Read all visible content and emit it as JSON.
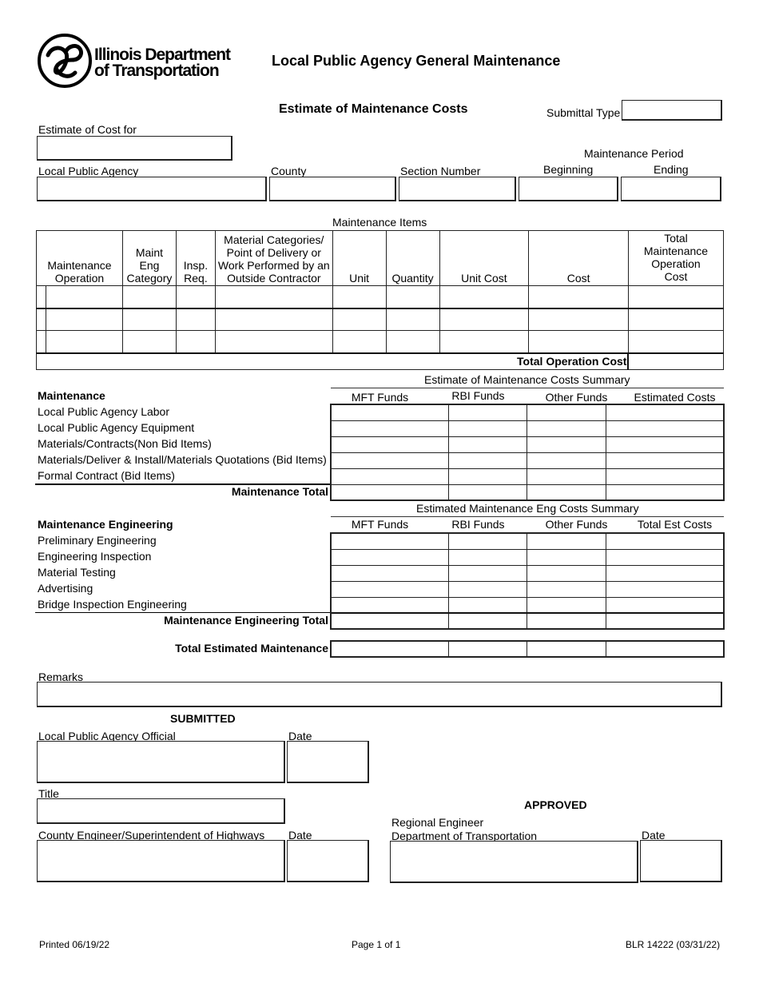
{
  "header": {
    "logo": {
      "icon": "idot-logo-icon",
      "line1": "Illinois Department",
      "line2": "of Transportation"
    },
    "title": "Local Public Agency General Maintenance",
    "subtitle": "Estimate of Maintenance Costs",
    "submittal_type_label": "Submittal Type",
    "submittal_type_value": ""
  },
  "fields": {
    "estimate_for_label": "Estimate of Cost for",
    "estimate_for_value": "",
    "lpa_label": "Local Public Agency",
    "lpa_value": "",
    "county_label": "County",
    "county_value": "",
    "section_label": "Section Number",
    "section_value": "",
    "period_label": "Maintenance Period",
    "beginning_label": "Beginning",
    "beginning_value": "",
    "ending_label": "Ending",
    "ending_value": ""
  },
  "items_table": {
    "caption": "Maintenance Items",
    "columns": [
      "Maintenance Operation",
      "Maint Eng Category",
      "Insp. Req.",
      "Material Categories/ Point of Delivery or Work Performed by an Outside Contractor",
      "Unit",
      "Quantity",
      "Unit Cost",
      "Cost",
      "Total Maintenance Operation Cost"
    ],
    "rows": [
      [
        "",
        "",
        "",
        "",
        "",
        "",
        "",
        "",
        ""
      ],
      [
        "",
        "",
        "",
        "",
        "",
        "",
        "",
        "",
        ""
      ],
      [
        "",
        "",
        "",
        "",
        "",
        "",
        "",
        "",
        ""
      ]
    ],
    "total_label": "Total Operation Cost",
    "total_value": ""
  },
  "maintenance": {
    "summary_caption": "Estimate of Maintenance Costs Summary",
    "heading": "Maintenance",
    "columns": [
      "MFT Funds",
      "RBI Funds",
      "Other Funds",
      "Estimated Costs"
    ],
    "rows": [
      {
        "label": "Local Public Agency Labor",
        "values": [
          "",
          "",
          "",
          ""
        ]
      },
      {
        "label": "Local Public Agency Equipment",
        "values": [
          "",
          "",
          "",
          ""
        ]
      },
      {
        "label": "Materials/Contracts(Non Bid Items)",
        "values": [
          "",
          "",
          "",
          ""
        ]
      },
      {
        "label": "Materials/Deliver & Install/Materials Quotations (Bid Items)",
        "values": [
          "",
          "",
          "",
          ""
        ]
      },
      {
        "label": "Formal Contract (Bid Items)",
        "values": [
          "",
          "",
          "",
          ""
        ]
      }
    ],
    "total_label": "Maintenance Total",
    "total_values": [
      "",
      "",
      "",
      ""
    ]
  },
  "engineering": {
    "summary_caption": "Estimated Maintenance Eng Costs Summary",
    "heading": "Maintenance Engineering",
    "columns": [
      "MFT Funds",
      "RBI Funds",
      "Other Funds",
      "Total Est Costs"
    ],
    "rows": [
      {
        "label": "Preliminary Engineering",
        "values": [
          "",
          "",
          "",
          ""
        ]
      },
      {
        "label": "Engineering Inspection",
        "values": [
          "",
          "",
          "",
          ""
        ]
      },
      {
        "label": "Material Testing",
        "values": [
          "",
          "",
          "",
          ""
        ]
      },
      {
        "label": "Advertising",
        "values": [
          "",
          "",
          "",
          ""
        ]
      },
      {
        "label": "Bridge Inspection Engineering",
        "values": [
          "",
          "",
          "",
          ""
        ]
      }
    ],
    "total_label": "Maintenance Engineering Total",
    "total_values": [
      "",
      "",
      "",
      ""
    ]
  },
  "grand_total": {
    "label": "Total Estimated Maintenance",
    "values": [
      "",
      "",
      "",
      ""
    ]
  },
  "remarks": {
    "label": "Remarks",
    "value": ""
  },
  "submitted": {
    "heading": "SUBMITTED",
    "official_label": "Local Public Agency Official",
    "official_value": "",
    "official_date_label": "Date",
    "official_date_value": "",
    "title_label": "Title",
    "title_value": "",
    "engineer_label": "County Engineer/Superintendent of Highways",
    "engineer_value": "",
    "engineer_date_label": "Date",
    "engineer_date_value": ""
  },
  "approved": {
    "heading": "APPROVED",
    "regional_label_1": "Regional Engineer",
    "regional_label_2": "Department of Transportation",
    "regional_value": "",
    "date_label": "Date",
    "date_value": ""
  },
  "footer": {
    "printed": "Printed 06/19/22",
    "page": "Page 1 of 1",
    "form_id": "BLR 14222 (03/31/22)"
  }
}
